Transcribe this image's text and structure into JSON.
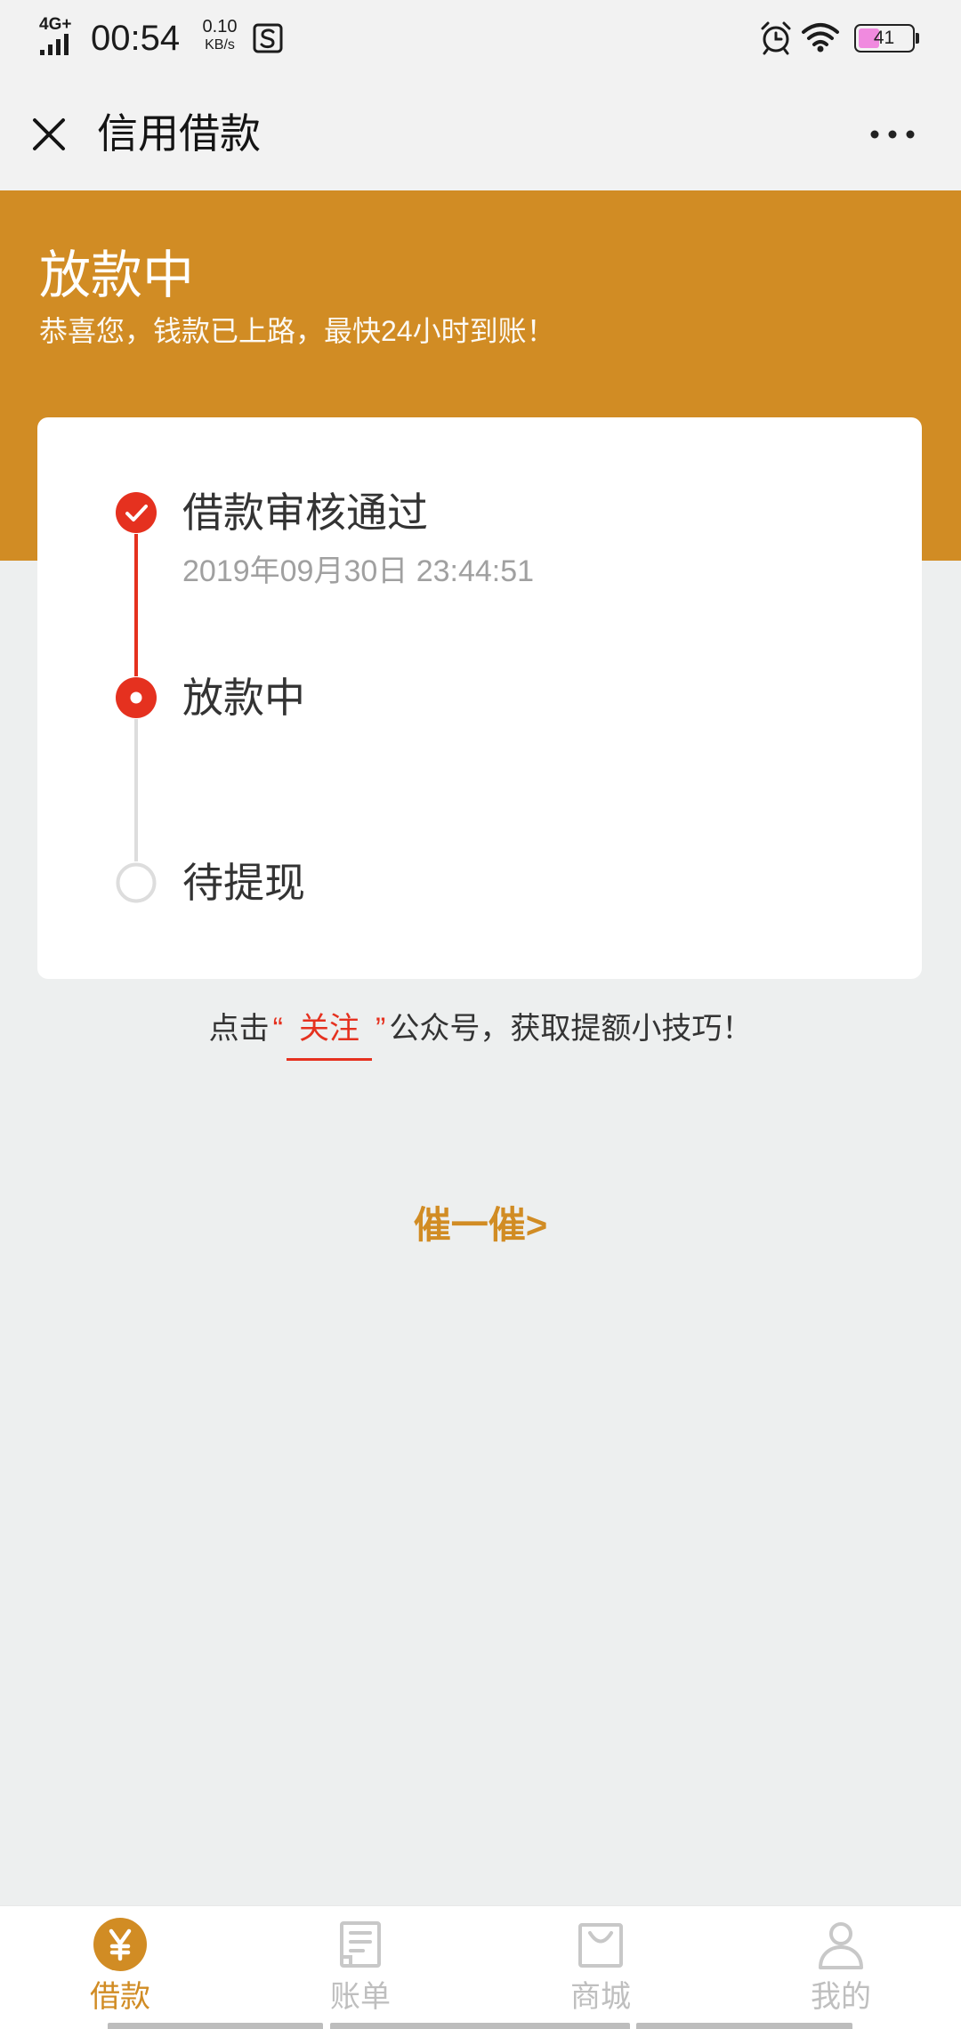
{
  "status_bar": {
    "network": "4G+",
    "time": "00:54",
    "speed_value": "0.10",
    "speed_unit": "KB/s",
    "battery_level": "41",
    "icons": [
      "signal-icon",
      "notification-s-icon",
      "alarm-icon",
      "wifi-icon",
      "battery-icon"
    ]
  },
  "nav": {
    "title": "信用借款",
    "close_icon": "close-icon",
    "more_icon": "more-icon"
  },
  "header": {
    "title": "放款中",
    "subtitle": "恭喜您，钱款已上路，最快24小时到账！"
  },
  "timeline": [
    {
      "label": "借款审核通过",
      "time": "2019年09月30日 23:44:51",
      "icon": "check-circle-icon"
    },
    {
      "label": "放款中",
      "icon": "current-dot-icon"
    },
    {
      "label": "待提现",
      "icon": "empty-circle-icon"
    }
  ],
  "tip": {
    "prefix": "点击",
    "quote_open": "“",
    "link": "关注",
    "quote_close": "”",
    "suffix": "公众号，获取提额小技巧！"
  },
  "urge_button": "催一催>",
  "tabs": [
    {
      "label": "借款",
      "icon": "yen-circle-icon",
      "active": true
    },
    {
      "label": "账单",
      "icon": "bill-icon",
      "active": false
    },
    {
      "label": "商城",
      "icon": "shop-bag-icon",
      "active": false
    },
    {
      "label": "我的",
      "icon": "user-icon",
      "active": false
    }
  ],
  "colors": {
    "accent": "#D18C24",
    "progress": "#E5311F",
    "pending": "#DDDDDD",
    "tab_inactive": "#BFBFBF",
    "battery_fill": "#F08ADF"
  }
}
